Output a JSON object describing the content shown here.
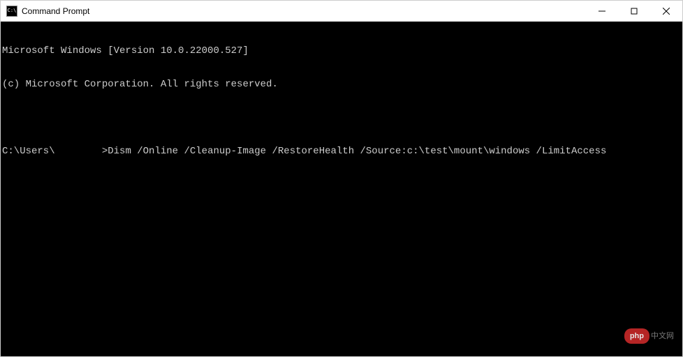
{
  "window": {
    "title": "Command Prompt",
    "icon_label": "C:\\"
  },
  "terminal": {
    "line1": "Microsoft Windows [Version 10.0.22000.527]",
    "line2": "(c) Microsoft Corporation. All rights reserved.",
    "prompt_prefix": "C:\\Users\\",
    "prompt_user": "        ",
    "prompt_sep": ">",
    "command": "Dism /Online /Cleanup-Image /RestoreHealth /Source:c:\\test\\mount\\windows /LimitAccess"
  },
  "watermark": {
    "badge": "php",
    "text": "中文网"
  }
}
